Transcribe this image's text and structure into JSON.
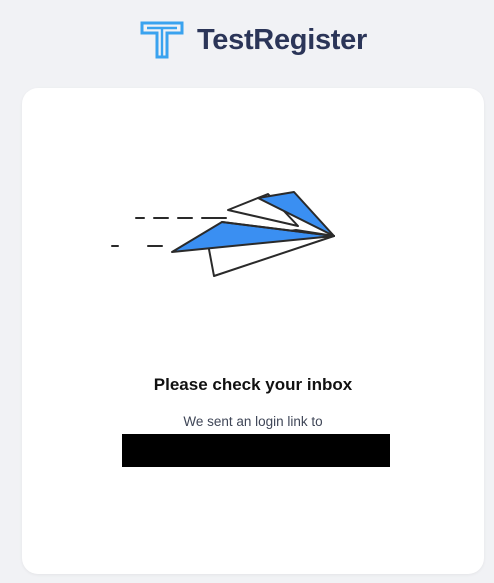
{
  "brand": {
    "name": "TestRegister",
    "logo_icon": "t-logo-icon",
    "text_color": "#2b3558",
    "logo_color": "#3aa3ef"
  },
  "confirmation": {
    "illustration_icon": "paper-plane-icon",
    "title": "Please check your inbox",
    "message": "We sent an login link to",
    "email": ""
  },
  "colors": {
    "background": "#f1f2f5",
    "card": "#ffffff",
    "plane_blue": "#3a8ff2"
  }
}
